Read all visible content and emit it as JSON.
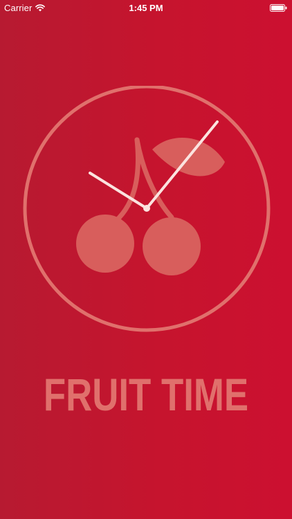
{
  "status_bar": {
    "carrier": "Carrier",
    "time": "1:45 PM",
    "wifi_icon": "wifi-icon",
    "battery_icon": "battery-full-icon"
  },
  "logo": {
    "icon": "cherry-clock-icon"
  },
  "app": {
    "title": "FRUIT TIME"
  },
  "colors": {
    "background_left": "#b71a31",
    "background_right": "#cc1030",
    "logo_accent": "#e0706c",
    "clock_hands": "#fbe3df"
  }
}
